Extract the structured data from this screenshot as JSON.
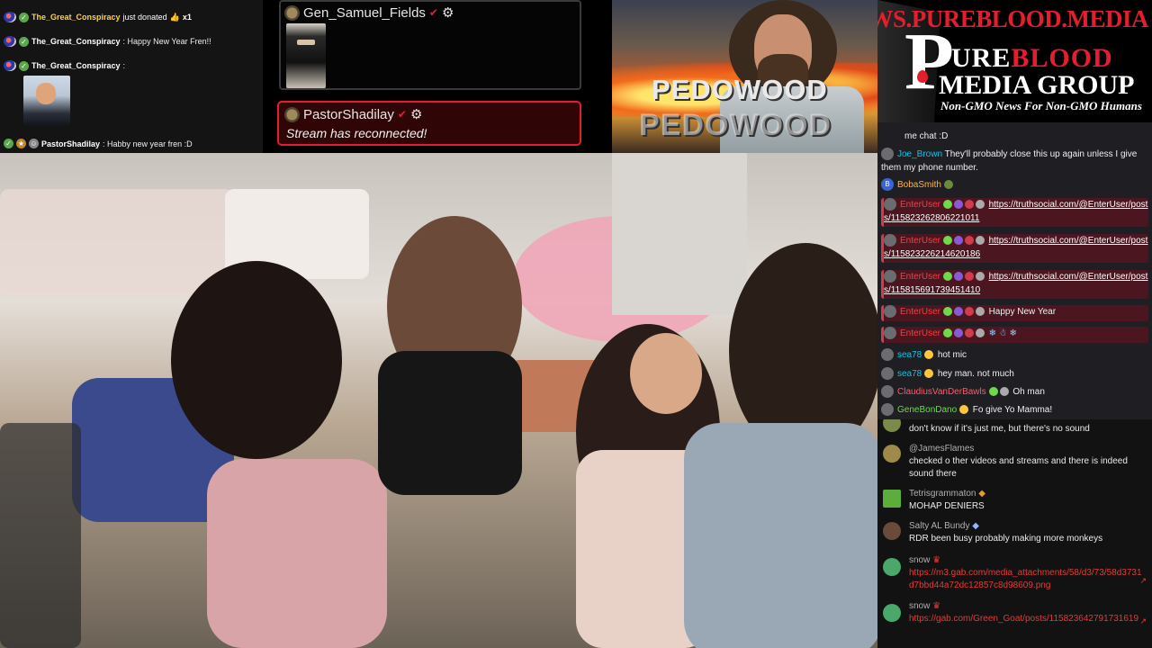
{
  "top_chat": {
    "donation": {
      "user": "The_Great_Conspiracy",
      "text": "just donated",
      "amount": "x1"
    },
    "line1": {
      "user": "The_Great_Conspiracy",
      "text": ": Happy New Year Fren!!"
    },
    "line2": {
      "user": "The_Great_Conspiracy",
      "text": ":"
    },
    "line3": {
      "user": "PastorShadilay",
      "text": ": Habby new year fren :D"
    }
  },
  "alert_top": {
    "user": "Gen_Samuel_Fields"
  },
  "alert_reconnect": {
    "user": "PastorShadilay",
    "message": "Stream has reconnected!"
  },
  "promo": {
    "word": "PEDOWOOD",
    "word_ghost": "PEDOWOOD"
  },
  "brand": {
    "url": "NEWS.PUREBLOOD.MEDIA",
    "cross_letter": "P",
    "pure": "URE",
    "blood": "BLOOD",
    "media": "MEDIA GROUP",
    "tagline": "Non-GMO News For Non-GMO Humans"
  },
  "chat_a": [
    {
      "user": "",
      "text": "me chat :D"
    },
    {
      "user": "Joe_Brown",
      "text": "They'll probably close this up again unless I give them my phone number."
    },
    {
      "user": "BobaSmith",
      "text": ""
    },
    {
      "user": "EnterUser",
      "link": "https://truthsocial.com/@EnterUser/posts/115823262806221011"
    },
    {
      "user": "EnterUser",
      "link": "https://truthsocial.com/@EnterUser/posts/115823226214620186"
    },
    {
      "user": "EnterUser",
      "link": "https://truthsocial.com/@EnterUser/posts/115815691739451410"
    },
    {
      "user": "EnterUser",
      "text": "Happy New Year"
    },
    {
      "user": "EnterUser",
      "text": ""
    },
    {
      "user": "sea78",
      "text": "hot mic"
    },
    {
      "user": "sea78",
      "text": "hey man. not much"
    },
    {
      "user": "ClaudiusVanDerBawls",
      "text": "Oh man"
    },
    {
      "user": "GeneBonDano",
      "text": "Fo give Yo Mamma!"
    }
  ],
  "chat_b": [
    {
      "user": "",
      "text": "don't know if it's just me, but there's no sound"
    },
    {
      "user": "@JamesFlames",
      "text": "checked o ther videos and streams and there is indeed sound there"
    },
    {
      "user": "Tetrisgrammaton",
      "text": "MOHAP DENIERS"
    },
    {
      "user": "Salty AL Bundy",
      "text": "RDR been busy probably making more monkeys"
    },
    {
      "user": "snow",
      "link": "https://m3.gab.com/media_attachments/58/d3/73/58d3731d7bbd44a72dc12857c8d98609.png"
    },
    {
      "user": "snow",
      "link": "https://gab.com/Green_Goat/posts/115823642791731619"
    }
  ],
  "colors": {
    "accent_red": "#e41e2d",
    "chat_bg": "#1f1f23",
    "highlight": "#4b1620"
  }
}
